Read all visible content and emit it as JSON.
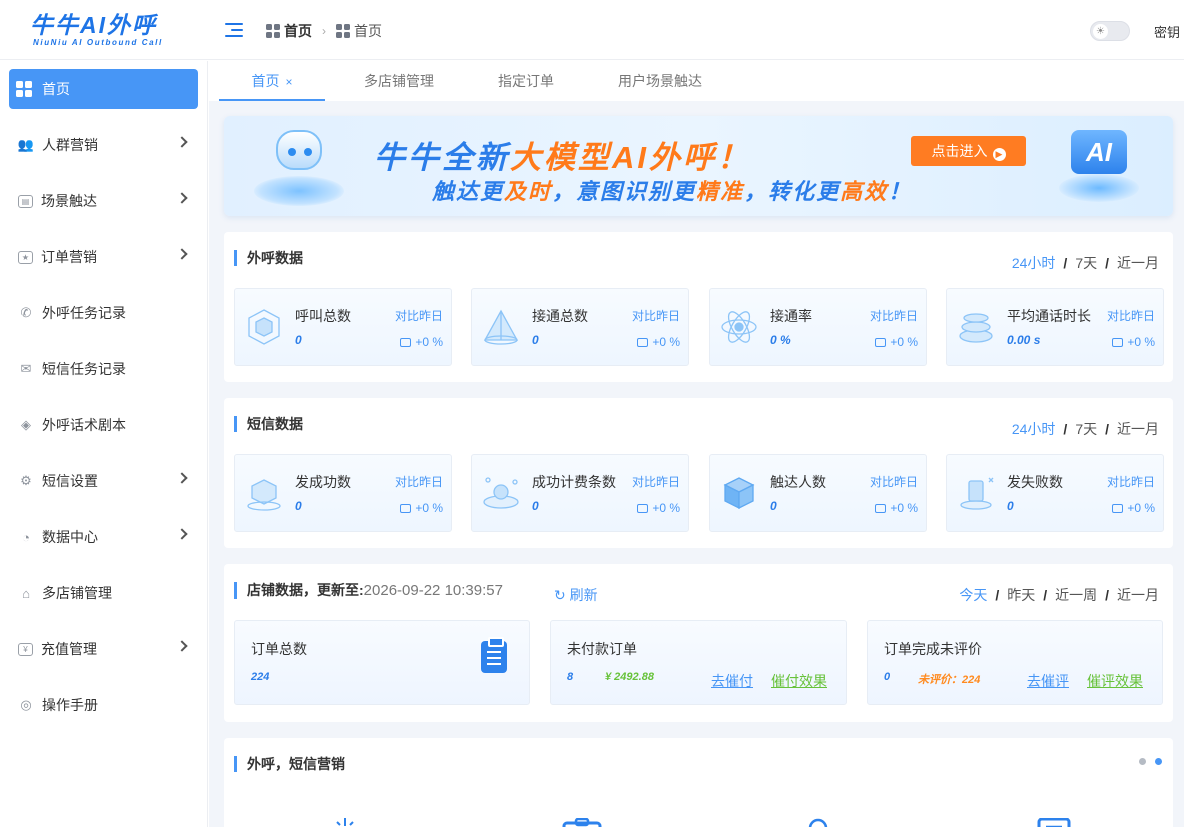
{
  "brand": {
    "title": "牛牛AI外呼",
    "subtitle": "NiuNiu AI Outbound Call",
    "color": "#1e74e6"
  },
  "header": {
    "breadcrumb": [
      "首页",
      "首页"
    ],
    "key_label": "密钥"
  },
  "sidebar": {
    "items": [
      {
        "label": "首页",
        "icon": "home-grid-icon",
        "expandable": false,
        "active": true
      },
      {
        "label": "人群营销",
        "icon": "people-icon",
        "expandable": true
      },
      {
        "label": "场景触达",
        "icon": "scene-icon",
        "expandable": true
      },
      {
        "label": "订单营销",
        "icon": "order-icon",
        "expandable": true
      },
      {
        "label": "外呼任务记录",
        "icon": "phone-icon",
        "expandable": false
      },
      {
        "label": "短信任务记录",
        "icon": "mail-icon",
        "expandable": false
      },
      {
        "label": "外呼话术剧本",
        "icon": "cube-icon",
        "expandable": false
      },
      {
        "label": "短信设置",
        "icon": "sms-settings-icon",
        "expandable": true
      },
      {
        "label": "数据中心",
        "icon": "pie-chart-icon",
        "expandable": true
      },
      {
        "label": "多店铺管理",
        "icon": "store-icon",
        "expandable": false
      },
      {
        "label": "充值管理",
        "icon": "recharge-icon",
        "expandable": true
      },
      {
        "label": "操作手册",
        "icon": "manual-icon",
        "expandable": false
      }
    ]
  },
  "tabs": [
    {
      "label": "首页",
      "active": true,
      "close": "×"
    },
    {
      "label": "多店铺管理"
    },
    {
      "label": "指定订单"
    },
    {
      "label": "用户场景触达"
    }
  ],
  "banner": {
    "title_a": "牛牛全新",
    "title_b": "大模型AI外呼！",
    "sub_1": "触达更",
    "sub_2": "及时",
    "sub_3": "，意图识别更",
    "sub_4": "精准",
    "sub_5": "，转化更",
    "sub_6": "高效",
    "sub_7": "！",
    "button": "点击进入",
    "ai_text": "AI"
  },
  "outbound": {
    "title": "外呼数据",
    "ranges": [
      "24小时",
      "7天",
      "近一月"
    ],
    "stats": [
      {
        "label": "呼叫总数",
        "value": "0",
        "compare": "对比昨日",
        "delta": "+0 %"
      },
      {
        "label": "接通总数",
        "value": "0",
        "compare": "对比昨日",
        "delta": "+0 %"
      },
      {
        "label": "接通率",
        "value": "0 %",
        "compare": "对比昨日",
        "delta": "+0 %"
      },
      {
        "label": "平均通话时长",
        "value": "0.00 s",
        "compare": "对比昨日",
        "delta": "+0 %"
      }
    ]
  },
  "sms": {
    "title": "短信数据",
    "ranges": [
      "24小时",
      "7天",
      "近一月"
    ],
    "stats": [
      {
        "label": "发成功数",
        "value": "0",
        "compare": "对比昨日",
        "delta": "+0 %"
      },
      {
        "label": "成功计费条数",
        "value": "0",
        "compare": "对比昨日",
        "delta": "+0 %"
      },
      {
        "label": "触达人数",
        "value": "0",
        "compare": "对比昨日",
        "delta": "+0 %"
      },
      {
        "label": "发失败数",
        "value": "0",
        "compare": "对比昨日",
        "delta": "+0 %"
      }
    ]
  },
  "shop": {
    "title": "店铺数据，更新至:",
    "updated": "2026-09-22 10:39:57",
    "refresh": "刷新",
    "ranges": [
      "今天",
      "昨天",
      "近一周",
      "近一月"
    ],
    "total_orders": {
      "label": "订单总数",
      "value": "224"
    },
    "unpaid": {
      "label": "未付款订单",
      "count": "8",
      "amount": "¥ 2492.88",
      "action": "去催付",
      "effect": "催付效果"
    },
    "unrated": {
      "label": "订单完成未评价",
      "count": "0",
      "pending": "未评价：224",
      "action": "去催评",
      "effect": "催评效果"
    }
  },
  "marketing": {
    "title": "外呼，短信营销"
  },
  "colors": {
    "accent": "#4796f6",
    "orange": "#ff7c22",
    "green": "#67c23a"
  }
}
